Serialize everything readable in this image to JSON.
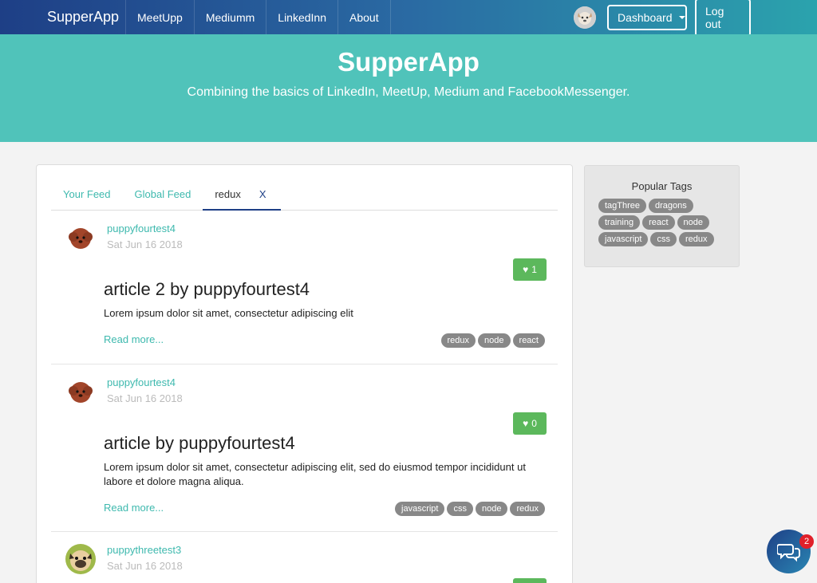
{
  "navbar": {
    "brand": "SupperApp",
    "links": [
      "MeetUpp",
      "Mediumm",
      "LinkedInn",
      "About"
    ],
    "dashboard_label": "Dashboard",
    "logout_label": "Log out"
  },
  "hero": {
    "title": "SupperApp",
    "subtitle": "Combining the basics of LinkedIn, MeetUp, Medium and FacebookMessenger."
  },
  "tabs": {
    "your_feed": "Your Feed",
    "global_feed": "Global Feed",
    "active_tag": "redux",
    "close": "X"
  },
  "articles": [
    {
      "author": "puppyfourtest4",
      "date": "Sat Jun 16 2018",
      "likes": "1",
      "title": "article 2 by puppyfourtest4",
      "description": "Lorem ipsum dolor sit amet, consectetur adipiscing elit",
      "read_more": "Read more...",
      "tags": [
        "redux",
        "node",
        "react"
      ]
    },
    {
      "author": "puppyfourtest4",
      "date": "Sat Jun 16 2018",
      "likes": "0",
      "title": "article by puppyfourtest4",
      "description": "Lorem ipsum dolor sit amet, consectetur adipiscing elit, sed do eiusmod tempor incididunt ut labore et dolore magna aliqua.",
      "read_more": "Read more...",
      "tags": [
        "javascript",
        "css",
        "node",
        "redux"
      ]
    },
    {
      "author": "puppythreetest3",
      "date": "Sat Jun 16 2018"
    }
  ],
  "sidebar": {
    "title": "Popular Tags",
    "tags": [
      "tagThree",
      "dragons",
      "training",
      "react",
      "node",
      "javascript",
      "css",
      "redux"
    ]
  },
  "chat": {
    "badge": "2"
  },
  "colors": {
    "accent": "#50c3ba",
    "link": "#3eb9ae",
    "nav_start": "#1e3f86",
    "like_green": "#5cb85c",
    "tag_gray": "#888888"
  }
}
